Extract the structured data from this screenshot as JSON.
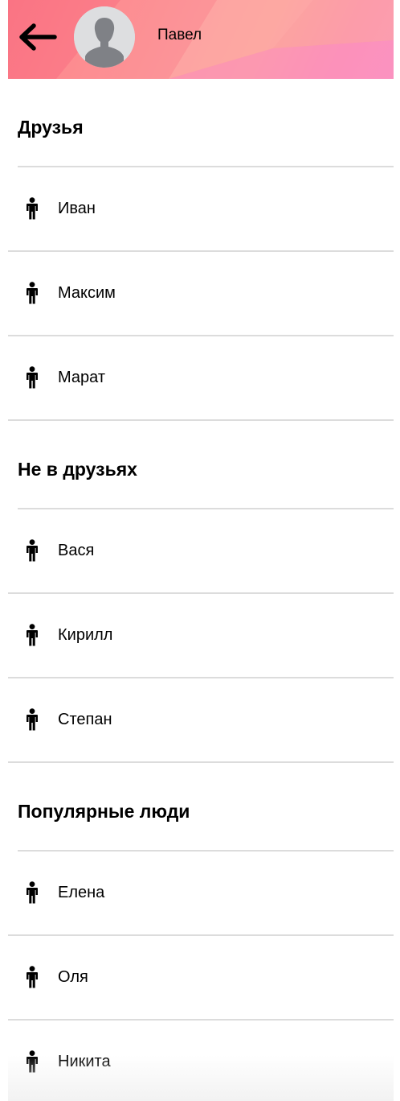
{
  "header": {
    "back_icon": "arrow-left-icon",
    "avatar_icon": "user-silhouette-icon",
    "user_name": "Павел"
  },
  "sections": [
    {
      "title": "Друзья",
      "people": [
        {
          "name": "Иван",
          "icon": "person-icon"
        },
        {
          "name": "Максим",
          "icon": "person-icon"
        },
        {
          "name": "Марат",
          "icon": "person-icon"
        }
      ]
    },
    {
      "title": "Не в друзьях",
      "people": [
        {
          "name": "Вася",
          "icon": "person-icon"
        },
        {
          "name": "Кирилл",
          "icon": "person-icon"
        },
        {
          "name": "Степан",
          "icon": "person-icon"
        }
      ]
    },
    {
      "title": "Популярные люди",
      "people": [
        {
          "name": "Елена",
          "icon": "person-icon"
        },
        {
          "name": "Оля",
          "icon": "person-icon"
        },
        {
          "name": "Никита",
          "icon": "person-icon"
        }
      ]
    }
  ]
}
